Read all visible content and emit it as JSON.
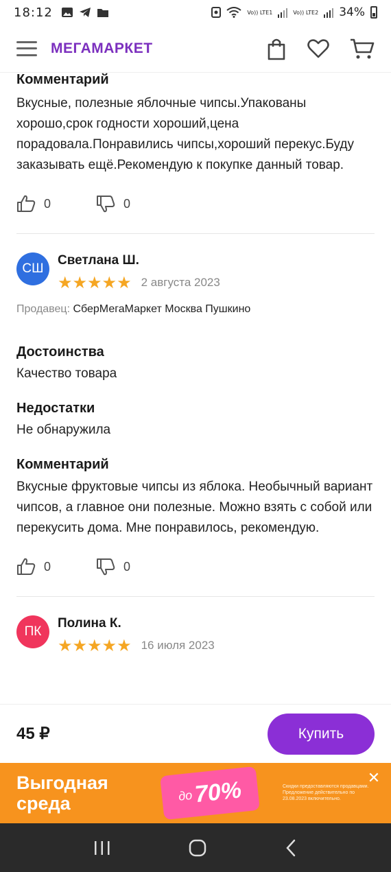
{
  "status_bar": {
    "time": "18:12",
    "net1": "Vo)) LTE1",
    "net2": "Vo)) LTE2",
    "battery": "34%"
  },
  "header": {
    "logo": "МЕГАМАРКЕТ"
  },
  "review_prev": {
    "comment_title": "Комментарий",
    "comment": "Вкусные, полезные яблочные чипсы.Упакованы хорошо,срок годности хороший,цена порадовала.Понравились чипсы,хороший перекус.Буду заказывать ещё.Рекомендую к покупке данный товар.",
    "likes": "0",
    "dislikes": "0"
  },
  "review_1": {
    "initials": "СШ",
    "name": "Светлана Ш.",
    "stars": "★★★★★",
    "rating": 5,
    "date": "2 августа 2023",
    "seller_label": "Продавец:",
    "seller": "СберМегаМаркет Москва Пушкино",
    "pros_title": "Достоинства",
    "pros": "Качество товара",
    "cons_title": "Недостатки",
    "cons": "Не обнаружила",
    "comment_title": "Комментарий",
    "comment": "Вкусные фруктовые чипсы из яблока. Необычный вариант чипсов, а главное они полезные. Можно взять с собой или перекусить дома. Мне понравилось, рекомендую.",
    "likes": "0",
    "dislikes": "0"
  },
  "review_2": {
    "initials": "ПК",
    "name": "Полина К.",
    "stars": "★★★★★",
    "rating": 5,
    "date": "16 июля 2023"
  },
  "buy": {
    "price": "45 ₽",
    "button": "Купить"
  },
  "banner": {
    "title": "Выгодная среда",
    "badge_prefix": "до",
    "badge_value": "70%",
    "fine_print": "Скидки предоставляются продавцами. Предложение действительно по 23.08.2023 включительно."
  },
  "colors": {
    "accent": "#8b2fd6",
    "logo": "#7b2fbe",
    "star": "#f5a623",
    "banner": "#f7931e"
  }
}
